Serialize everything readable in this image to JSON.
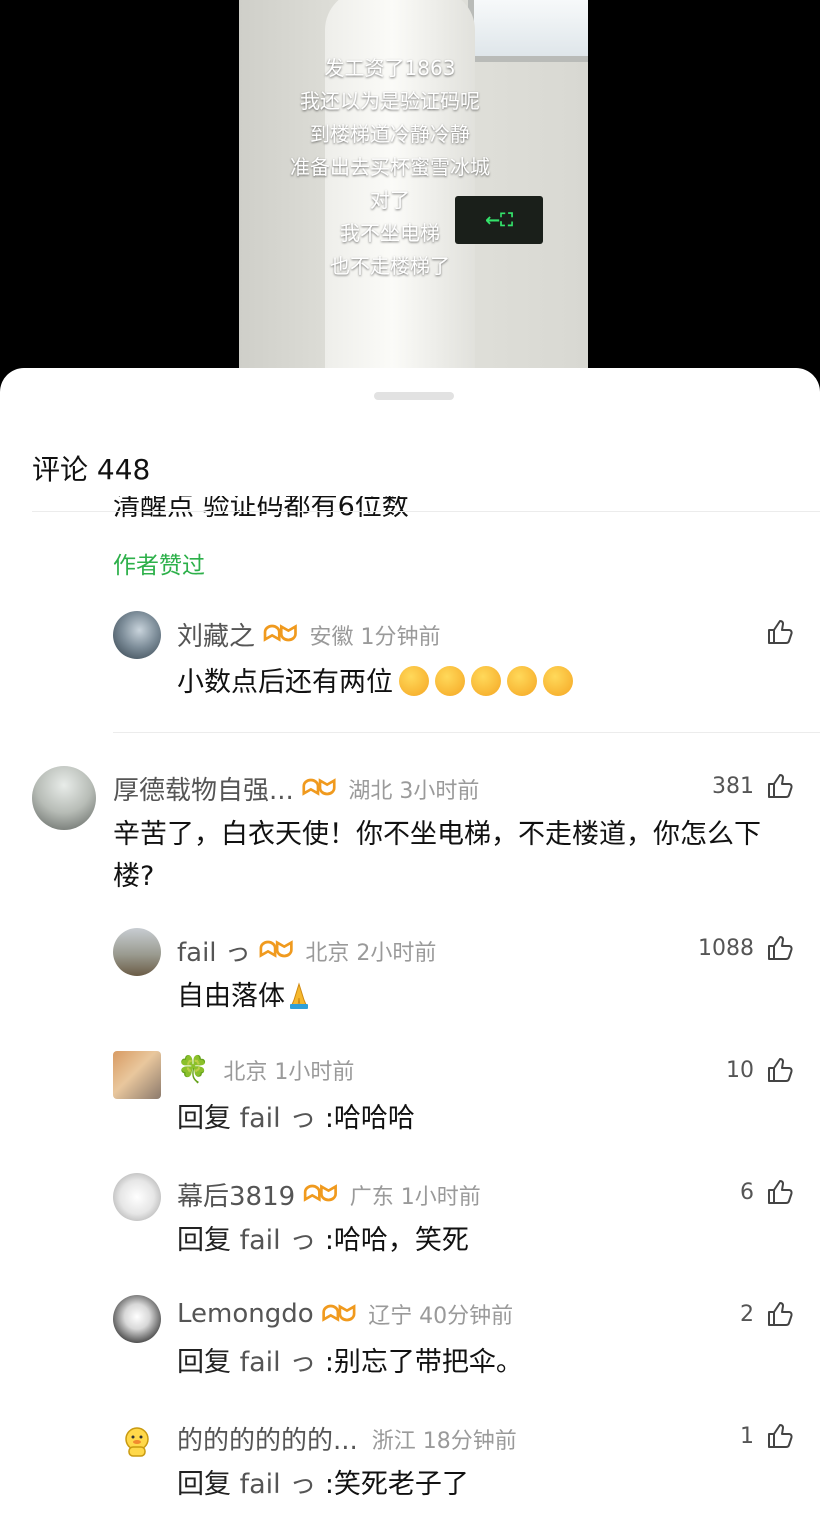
{
  "video": {
    "caption_lines": [
      "发工资了1863",
      "我还以为是验证码呢",
      "到楼梯道冷静冷静",
      "准备出去买杯蜜雪冰城",
      "对了",
      "我不坐电梯",
      "也不走楼梯了"
    ]
  },
  "sheet": {
    "title": "评论 448",
    "partial_comment_text": "清醒点 验证码都有6位数",
    "author_liked": "作者赞过"
  },
  "comments": [
    {
      "id": "c1",
      "user": "刘藏之",
      "badge": true,
      "location_time": "安徽 1分钟前",
      "likes": "",
      "text": "小数点后还有两位",
      "emoji": "laugh-cry-icon x5",
      "avatar": "landscape-avatar"
    },
    {
      "id": "c2",
      "user": "厚德载物自强...",
      "badge": true,
      "location_time": "湖北 3小时前",
      "likes": "381",
      "text": "辛苦了，白衣天使！你不坐电梯，不走楼道，你怎么下楼?",
      "avatar": "statue-avatar"
    },
    {
      "id": "c3",
      "user": "fail っ",
      "badge": true,
      "location_time": "北京 2小时前",
      "likes": "1088",
      "text": "自由落体",
      "emoji": "pray-icon",
      "avatar": "field-avatar"
    },
    {
      "id": "c4",
      "user": "🍀",
      "badge": false,
      "location_time": "北京 1小时前",
      "likes": "10",
      "reply_prefix": "回复",
      "reply_to": "fail っ",
      "text": ":哈哈哈",
      "avatar": "cartoon-avatar"
    },
    {
      "id": "c5",
      "user": "幕后3819",
      "badge": true,
      "location_time": "广东 1小时前",
      "likes": "6",
      "reply_prefix": "回复",
      "reply_to": "fail っ",
      "text": ":哈哈，笑死",
      "avatar": "sketch-avatar"
    },
    {
      "id": "c6",
      "user": "Lemongdo",
      "badge": true,
      "location_time": "辽宁 40分钟前",
      "likes": "2",
      "reply_prefix": "回复",
      "reply_to": "fail っ",
      "text": ":别忘了带把伞。",
      "avatar": "bird-avatar"
    },
    {
      "id": "c7",
      "user": "的的的的的的...",
      "badge": false,
      "location_time": "浙江 18分钟前",
      "likes": "1",
      "reply_prefix": "回复",
      "reply_to": "fail っ",
      "text": ":笑死老子了",
      "avatar": "duck-avatar"
    }
  ],
  "colors": {
    "accent_green": "#2db04a",
    "badge_orange": "#f09a1e",
    "meta_gray": "#9a9a9a"
  }
}
